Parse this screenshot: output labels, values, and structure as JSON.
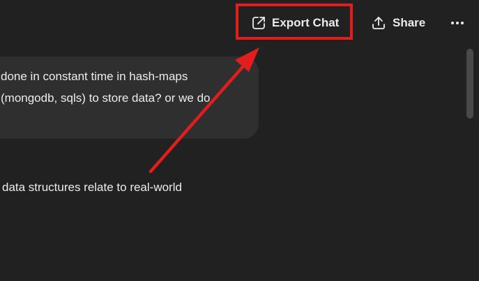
{
  "header": {
    "export_label": "Export Chat",
    "share_label": "Share"
  },
  "conversation": {
    "user_message_lines": [
      " done in constant time in hash-maps",
      "(mongodb, sqls) to store data? or we do"
    ],
    "assistant_partial": " data structures relate to real-world"
  },
  "colors": {
    "background": "#212121",
    "bubble": "#2f2f2f",
    "text": "#ececec",
    "annotation": "#e21d1d"
  },
  "icons": {
    "export": "external-link-icon",
    "share": "upload-icon",
    "more": "ellipsis-icon"
  }
}
